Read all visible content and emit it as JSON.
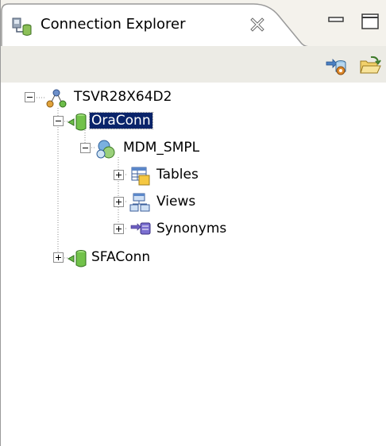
{
  "tab": {
    "title": "Connection Explorer",
    "icon": "connection-explorer-icon",
    "close_icon": "close-icon"
  },
  "window_controls": {
    "minimize_icon": "minimize-icon",
    "maximize_icon": "maximize-icon"
  },
  "toolbar": {
    "buttons": [
      {
        "icon": "refresh-database-icon"
      },
      {
        "icon": "open-folder-icon"
      }
    ]
  },
  "tree": {
    "server": {
      "label": "TSVR28X64D2",
      "icon": "server-network-icon",
      "expanded": true
    },
    "connections": [
      {
        "label": "OraConn",
        "icon": "database-connection-icon",
        "expanded": true,
        "selected": true,
        "schema": {
          "label": "MDM_SMPL",
          "icon": "schema-icon",
          "expanded": true,
          "children": [
            {
              "label": "Tables",
              "icon": "table-icon",
              "expanded": false
            },
            {
              "label": "Views",
              "icon": "view-icon",
              "expanded": false
            },
            {
              "label": "Synonyms",
              "icon": "synonym-icon",
              "expanded": false
            }
          ]
        }
      },
      {
        "label": "SFAConn",
        "icon": "database-connection-icon",
        "expanded": false,
        "selected": false
      }
    ]
  },
  "colors": {
    "selection_bg": "#0a246a",
    "header_bg": "#f4f2ec",
    "toolbar_bg": "#ecebe5"
  }
}
